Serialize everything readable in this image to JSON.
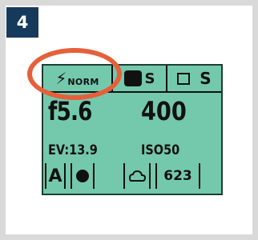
{
  "step": {
    "number": "4"
  },
  "lcd": {
    "flash": {
      "icon": "flash-icon",
      "mode": "NORM"
    },
    "focus": {
      "icon": "af-block-icon",
      "mode": "S"
    },
    "drive": {
      "icon": "single-frame-icon",
      "mode": "S"
    },
    "aperture": "f5.6",
    "shutter": "400",
    "ev": "EV:13.9",
    "iso": "ISO50",
    "exposure_mode": "A",
    "metering_icon": "spot-metering-icon",
    "white_balance_icon": "cloudy-icon",
    "frames_remaining": "623"
  },
  "annotation": {
    "color": "#e5603a"
  },
  "colors": {
    "lcd_bg": "#74c9ad",
    "badge_bg": "#163a5c"
  }
}
